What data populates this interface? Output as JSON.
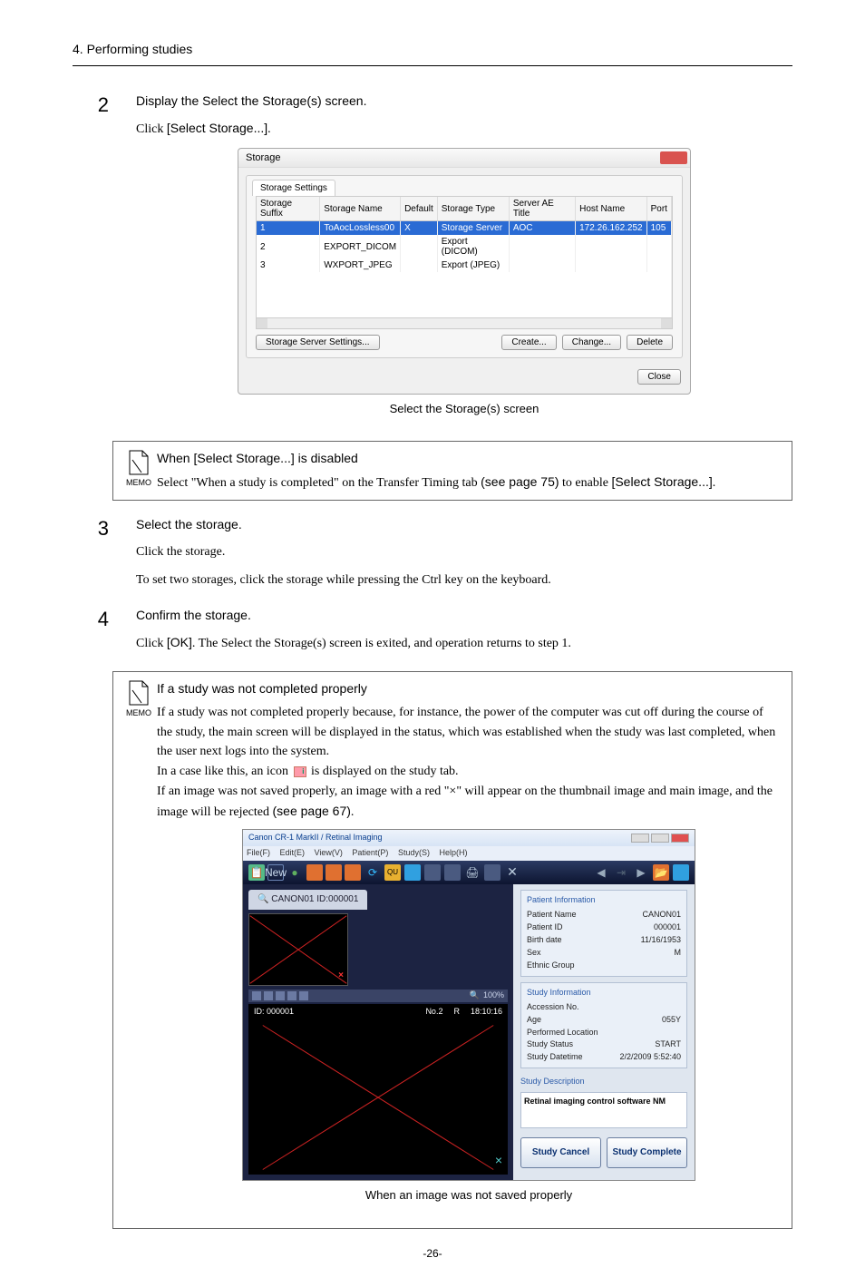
{
  "breadcrumb": "4. Performing studies",
  "page_number": "-26-",
  "steps": {
    "2": {
      "num": "2",
      "title": "Display the Select the Storage(s) screen.",
      "text_prefix": "Click ",
      "link": "[Select Storage...]",
      "text_suffix": "."
    },
    "3": {
      "num": "3",
      "title": "Select the storage.",
      "line1": "Click the storage.",
      "line2": "To set two storages, click the storage while pressing the Ctrl key on the keyboard."
    },
    "4": {
      "num": "4",
      "title": "Confirm the storage.",
      "text_prefix": "Click ",
      "link": "[OK]",
      "text_suffix": ". The Select the Storage(s) screen is exited, and operation returns to step 1."
    }
  },
  "storage_dialog": {
    "title": "Storage",
    "tab": "Storage Settings",
    "headers": [
      "Storage Suffix",
      "Storage Name",
      "Default",
      "Storage Type",
      "Server AE Title",
      "Host Name",
      "Port"
    ],
    "rows": [
      {
        "suffix": "1",
        "name": "ToAocLossless00",
        "default": "X",
        "type": "Storage Server",
        "ae": "AOC",
        "host": "172.26.162.252",
        "port": "105",
        "sel": true
      },
      {
        "suffix": "2",
        "name": "EXPORT_DICOM",
        "default": "",
        "type": "Export (DICOM)",
        "ae": "",
        "host": "",
        "port": ""
      },
      {
        "suffix": "3",
        "name": "WXPORT_JPEG",
        "default": "",
        "type": "Export (JPEG)",
        "ae": "",
        "host": "",
        "port": ""
      }
    ],
    "btn_settings": "Storage Server Settings...",
    "btn_create": "Create...",
    "btn_change": "Change...",
    "btn_delete": "Delete",
    "btn_close": "Close",
    "caption": "Select the Storage(s) screen"
  },
  "memo_icon_label": "MEMO",
  "memo1": {
    "title": "When [Select Storage...] is disabled",
    "p1a": "Select \"When a study is completed\" on the Transfer Timing tab ",
    "p1b": "(see page 75)",
    "p1c": " to enable ",
    "p1d": "[Select Storage...]",
    "p1e": "."
  },
  "memo2": {
    "title": "If a study was not completed properly",
    "p1": "If a study was not completed properly because, for instance, the power of the computer was cut off during the course of the study, the main screen will be displayed in the status, which was established when the study was last completed, when the user next logs into the system.",
    "p2a": "In a case like this, an icon ",
    "p2b": " is displayed on the study tab.",
    "p3a": "If an image was not saved properly, an image with a red \"×\" will appear on the thumbnail image and main image, and the image will be rejected ",
    "p3b": "(see page 67)",
    "p3c": "."
  },
  "app": {
    "title": "Canon CR-1 MarkII / Retinal Imaging",
    "menus": [
      "File(F)",
      "Edit(E)",
      "View(V)",
      "Patient(P)",
      "Study(S)",
      "Help(H)"
    ],
    "study_tab_prefix": "🔍 ",
    "study_tab": "CANON01 ID:000001",
    "thumb_strip_right": "100%",
    "mainbar_id": "ID: 000001",
    "mainbar_no": "No.2",
    "mainbar_eye": "R",
    "mainbar_time": "18:10:16",
    "patient_info": {
      "title": "Patient Information",
      "rows": [
        {
          "k": "Patient Name",
          "v": "CANON01"
        },
        {
          "k": "Patient ID",
          "v": "000001"
        },
        {
          "k": "Birth date",
          "v": "11/16/1953"
        },
        {
          "k": "Sex",
          "v": "M"
        },
        {
          "k": "Ethnic Group",
          "v": ""
        }
      ]
    },
    "study_info": {
      "title": "Study Information",
      "rows": [
        {
          "k": "Accession No.",
          "v": ""
        },
        {
          "k": "Age",
          "v": "055Y"
        },
        {
          "k": "Performed Location",
          "v": ""
        },
        {
          "k": "Study Status",
          "v": "START"
        },
        {
          "k": "Study Datetime",
          "v": "2/2/2009 5:52:40"
        }
      ]
    },
    "study_desc_title": "Study Description",
    "study_desc": "Retinal imaging control software NM",
    "btn_cancel": "Study Cancel",
    "btn_complete": "Study Complete",
    "caption": "When an image was not saved properly"
  }
}
